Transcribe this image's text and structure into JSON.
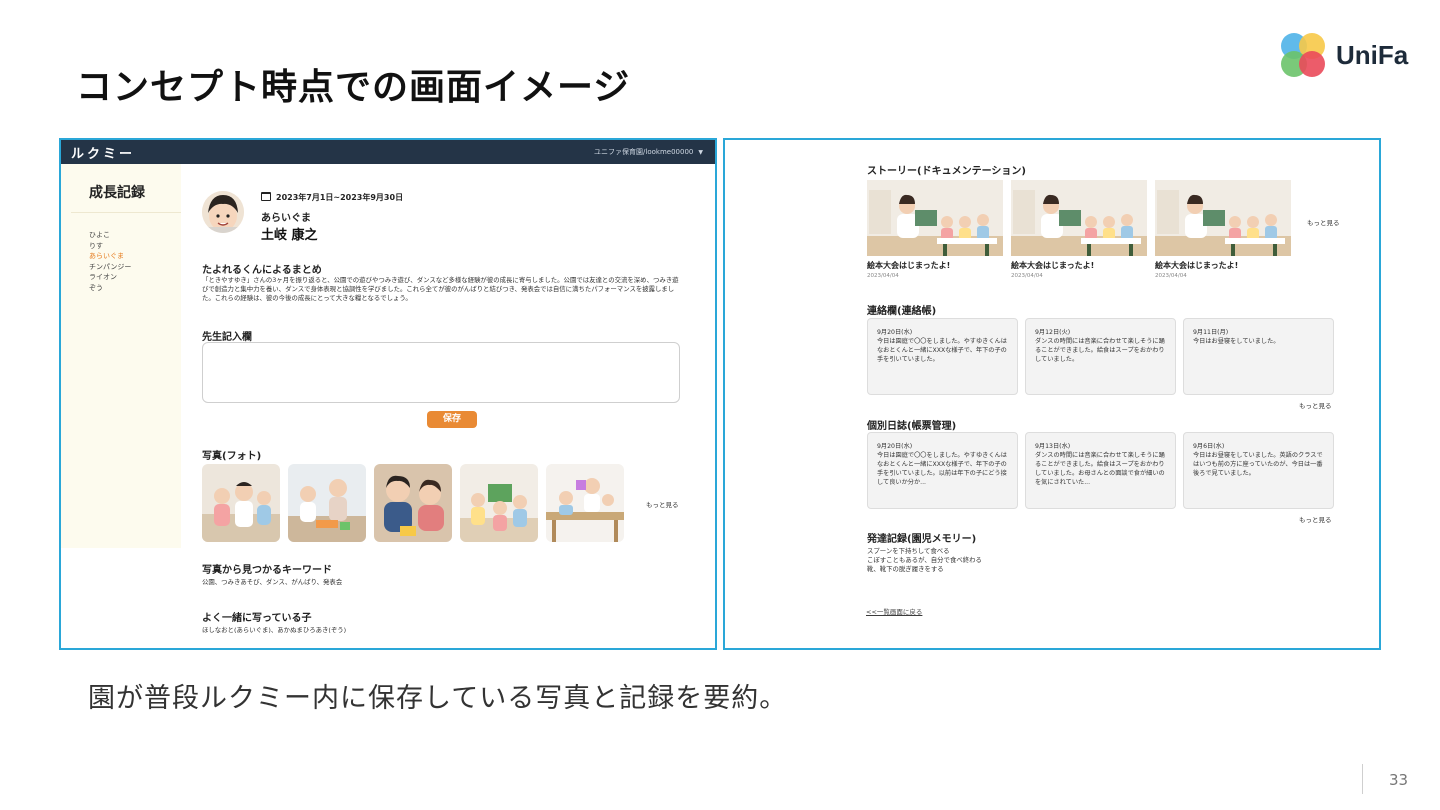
{
  "slide": {
    "title": "コンセプト時点での画面イメージ",
    "caption": "園が普段ルクミー内に保存している写真と記録を要約。",
    "page_number": "33",
    "logo": {
      "name": "UniFa",
      "colors": [
        "#4fb3e8",
        "#f7c948",
        "#6cc36a",
        "#ea4a5a"
      ]
    }
  },
  "left_app": {
    "brand": "ルクミー",
    "user_menu": "ユニファ保育園/lookme00000",
    "sidebar": {
      "title": "成長記録",
      "items": [
        "ひよこ",
        "りす",
        "あらいぐま",
        "チンパンジー",
        "ライオン",
        "ぞう"
      ],
      "active_index": 2
    },
    "profile": {
      "period": "2023年7月1日~2023年9月30日",
      "class": "あらいぐま",
      "name": "土岐 康之"
    },
    "summary": {
      "title": "たよれるくんによるまとめ",
      "text": "「ときやすゆき」さんの3ヶ月を振り返ると、公園での遊びやつみき遊び、ダンスなど多様な経験が彼の成長に寄与しました。公園では友達との交流を深め、つみき遊びで創造力と集中力を養い、ダンスで身体表現と協調性を学びました。これら全てが彼のがんばりと結びつき、発表会では自信に満ちたパフォーマンスを披露しました。これらの経験は、彼の今後の成長にとって大きな糧となるでしょう。"
    },
    "teacher_note": {
      "title": "先生記入欄",
      "value": ""
    },
    "save_label": "保存",
    "photos": {
      "title": "写真(フォト)",
      "more": "もっと見る"
    },
    "keywords": {
      "title": "写真から見つかるキーワード",
      "text": "公園、つみきあそび、ダンス、がんばり、発表会"
    },
    "friends": {
      "title": "よく一緒に写っている子",
      "text": "ほしなおと(あらいぐま)、あかぬまひろあき(ぞう)"
    }
  },
  "right_app": {
    "story": {
      "title": "ストーリー(ドキュメンテーション)",
      "more": "もっと見る",
      "items": [
        {
          "title": "絵本大会はじまったよ!",
          "date": "2023/04/04"
        },
        {
          "title": "絵本大会はじまったよ!",
          "date": "2023/04/04"
        },
        {
          "title": "絵本大会はじまったよ!",
          "date": "2023/04/04"
        }
      ]
    },
    "contact": {
      "title": "連絡欄(連絡帳)",
      "more": "もっと見る",
      "items": [
        {
          "date": "9月20日(水)",
          "text": "今日は園庭で〇〇をしました。やすゆきくんはなおとくんと一緒にXXXな様子で、年下の子の手を引いていました。"
        },
        {
          "date": "9月12日(火)",
          "text": "ダンスの時間には音楽に合わせて楽しそうに踊ることができました。給食はスープをおかわりしていました。"
        },
        {
          "date": "9月11日(月)",
          "text": "今日はお昼寝をしていました。"
        }
      ]
    },
    "diary": {
      "title": "個別日誌(帳票管理)",
      "more": "もっと見る",
      "items": [
        {
          "date": "9月20日(水)",
          "text": "今日は園庭で〇〇をしました。やすゆきくんはなおとくんと一緒にXXXな様子で、年下の子の手を引いていました。以前は年下の子にどう接して良いか分か..."
        },
        {
          "date": "9月13日(水)",
          "text": "ダンスの時間には音楽に合わせて楽しそうに踊ることができました。給食はスープをおかわりしていました。お母さんとの面談で食が細いのを気にされていた..."
        },
        {
          "date": "9月6日(水)",
          "text": "今日はお昼寝をしていました。英語のクラスではいつも前の方に座っていたのが、今日は一番後ろで見ていました。"
        }
      ]
    },
    "development": {
      "title": "発達記録(園児メモリー)",
      "lines": [
        "スプーンを下持ちして食べる",
        "こぼすこともあるが、自分で食べ終わる",
        "靴、靴下の脱ぎ履きをする"
      ]
    },
    "back_link": "<<一覧画面に戻る"
  }
}
